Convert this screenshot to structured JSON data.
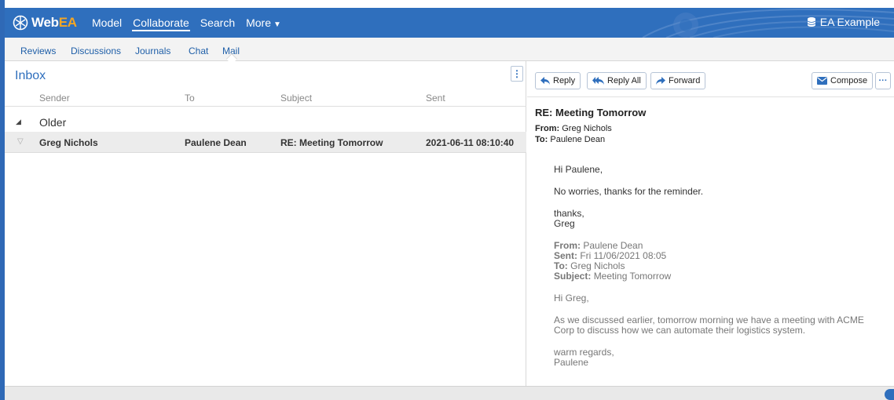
{
  "app": {
    "logo": {
      "part1": "Web",
      "part2": "EA"
    },
    "nav": [
      "Model",
      "Collaborate",
      "Search",
      "More"
    ],
    "active_nav": "Collaborate",
    "database": "EA Example",
    "colors": {
      "brand": "#2f6fbd",
      "logo_accent": "#f5a623"
    }
  },
  "subtabs": [
    "Reviews",
    "Discussions",
    "Journals",
    "Chat",
    "Mail"
  ],
  "active_subtab": "Mail",
  "inbox": {
    "title": "Inbox",
    "columns": {
      "sender": "Sender",
      "to": "To",
      "subject": "Subject",
      "sent": "Sent"
    },
    "group": "Older",
    "messages": [
      {
        "sender": "Greg Nichols",
        "to": "Paulene Dean",
        "subject": "RE: Meeting Tomorrow",
        "sent": "2021-06-11 08:10:40"
      }
    ]
  },
  "toolbar": {
    "reply": "Reply",
    "reply_all": "Reply All",
    "forward": "Forward",
    "compose": "Compose",
    "more": "···"
  },
  "message": {
    "subject": "RE: Meeting Tomorrow",
    "from_label": "From:",
    "from": "Greg Nichols",
    "to_label": "To:",
    "to": "Paulene Dean",
    "greeting": "Hi Paulene,",
    "line1": "No worries, thanks for the reminder.",
    "signoff1": "thanks,",
    "signoff2": "Greg",
    "quoted": {
      "from_label": "From:",
      "from": "Paulene Dean",
      "sent_label": "Sent:",
      "sent": "Fri 11/06/2021 08:05",
      "to_label": "To:",
      "to": "Greg Nichols",
      "subject_label": "Subject:",
      "subject": "Meeting Tomorrow",
      "greeting": "Hi Greg,",
      "body1": "As we discussed earlier, tomorrow morning we have a meeting with ACME",
      "body2": "Corp to discuss how we can automate their logistics system.",
      "closing1": "warm regards,",
      "closing2": "Paulene"
    }
  }
}
